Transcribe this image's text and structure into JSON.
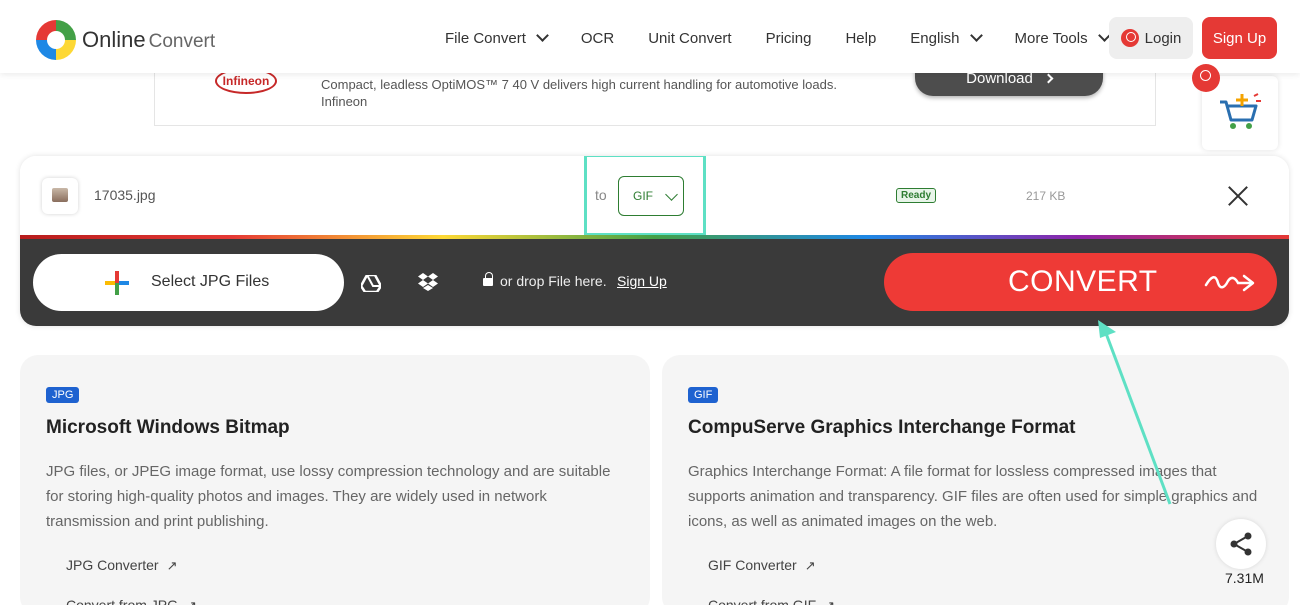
{
  "header": {
    "logo_main": "Online",
    "logo_sub": "Convert",
    "nav": [
      {
        "label": "File Convert",
        "has_dropdown": true
      },
      {
        "label": "OCR",
        "has_dropdown": false
      },
      {
        "label": "Unit Convert",
        "has_dropdown": false
      },
      {
        "label": "Pricing",
        "has_dropdown": false
      },
      {
        "label": "Help",
        "has_dropdown": false
      },
      {
        "label": "English",
        "has_dropdown": true
      },
      {
        "label": "More Tools",
        "has_dropdown": true
      }
    ],
    "login_label": "Login",
    "signup_label": "Sign Up"
  },
  "ad": {
    "brand": "Infineon",
    "line1": "Compact, leadless OptiMOS™ 7 40 V delivers high current handling for automotive loads.",
    "line2": "Infineon",
    "button_label": "Download"
  },
  "file": {
    "name": "17035.jpg",
    "to_label": "to",
    "target_format": "GIF",
    "status": "Ready",
    "size": "217 KB"
  },
  "upload": {
    "select_label": "Select JPG Files",
    "drop_text": "or drop File here.",
    "signup_link": "Sign Up",
    "convert_label": "CONVERT"
  },
  "cards": [
    {
      "tag": "JPG",
      "title": "Microsoft Windows Bitmap",
      "description": "JPG files, or JPEG image format, use lossy compression technology and are suitable for storing high-quality photos and images. They are widely used in network transmission and print publishing.",
      "links": [
        "JPG Converter",
        "Convert from JPG"
      ]
    },
    {
      "tag": "GIF",
      "title": "CompuServe Graphics Interchange Format",
      "description": "Graphics Interchange Format: A file format for lossless compressed images that supports animation and transparency. GIF files are often used for simple graphics and icons, as well as animated images on the web.",
      "links": [
        "GIF Converter",
        "Convert from GIF"
      ]
    }
  ],
  "share": {
    "count": "7.31M"
  },
  "colors": {
    "brand_red": "#e53935",
    "highlight_teal": "#5ee0c4",
    "tag_blue": "#1e62d0",
    "ready_green": "#2e7d32"
  }
}
